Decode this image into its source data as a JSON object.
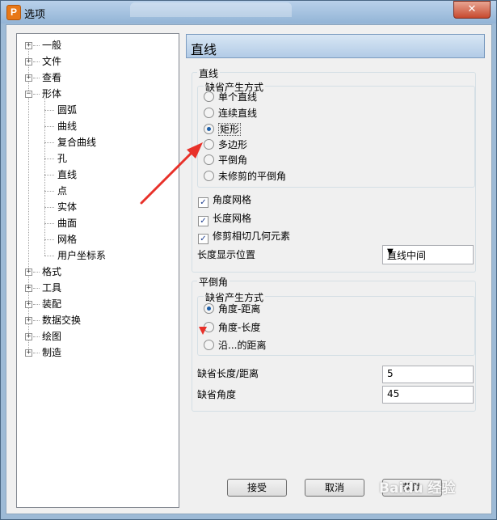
{
  "window": {
    "title": "选项",
    "app_icon_letter": "P",
    "close_glyph": "✕"
  },
  "tree": {
    "items": [
      {
        "label": "一般",
        "expander": "+"
      },
      {
        "label": "文件",
        "expander": "+"
      },
      {
        "label": "查看",
        "expander": "+"
      },
      {
        "label": "形体",
        "expander": "−"
      },
      {
        "label": "圆弧"
      },
      {
        "label": "曲线"
      },
      {
        "label": "复合曲线"
      },
      {
        "label": "孔"
      },
      {
        "label": "直线"
      },
      {
        "label": "点"
      },
      {
        "label": "实体"
      },
      {
        "label": "曲面"
      },
      {
        "label": "网格"
      },
      {
        "label": "用户坐标系"
      },
      {
        "label": "格式",
        "expander": "+"
      },
      {
        "label": "工具",
        "expander": "+"
      },
      {
        "label": "装配",
        "expander": "+"
      },
      {
        "label": "数据交换",
        "expander": "+"
      },
      {
        "label": "绘图",
        "expander": "+"
      },
      {
        "label": "制造",
        "expander": "+"
      }
    ]
  },
  "pane": {
    "title": "直线",
    "line_group": {
      "label": "直线",
      "method_group": {
        "label": "缺省产生方式",
        "options": [
          "单个直线",
          "连续直线",
          "矩形",
          "多边形",
          "平倒角",
          "未修剪的平倒角"
        ],
        "selected": "矩形"
      },
      "checkboxes": [
        {
          "label": "角度网格",
          "checked": true
        },
        {
          "label": "长度网格",
          "checked": true
        },
        {
          "label": "修剪相切几何元素",
          "checked": true
        }
      ],
      "length_position": {
        "label": "长度显示位置",
        "value": "直线中间"
      }
    },
    "chamfer_group": {
      "label": "平倒角",
      "method_group": {
        "label": "缺省产生方式",
        "options": [
          "角度-距离",
          "角度-长度",
          "沿...的距离"
        ],
        "selected": "角度-距离"
      },
      "default_length": {
        "label": "缺省长度/距离",
        "value": "5"
      },
      "default_angle": {
        "label": "缺省角度",
        "value": "45"
      }
    }
  },
  "buttons": {
    "ok": "接受",
    "cancel": "取消",
    "help": "帮助"
  },
  "watermark": "Baidu 经验",
  "colors": {
    "annotation_arrow": "#e8312a",
    "titlebar": "#a9c5e2",
    "selected_radio": "#1e5fa8"
  }
}
